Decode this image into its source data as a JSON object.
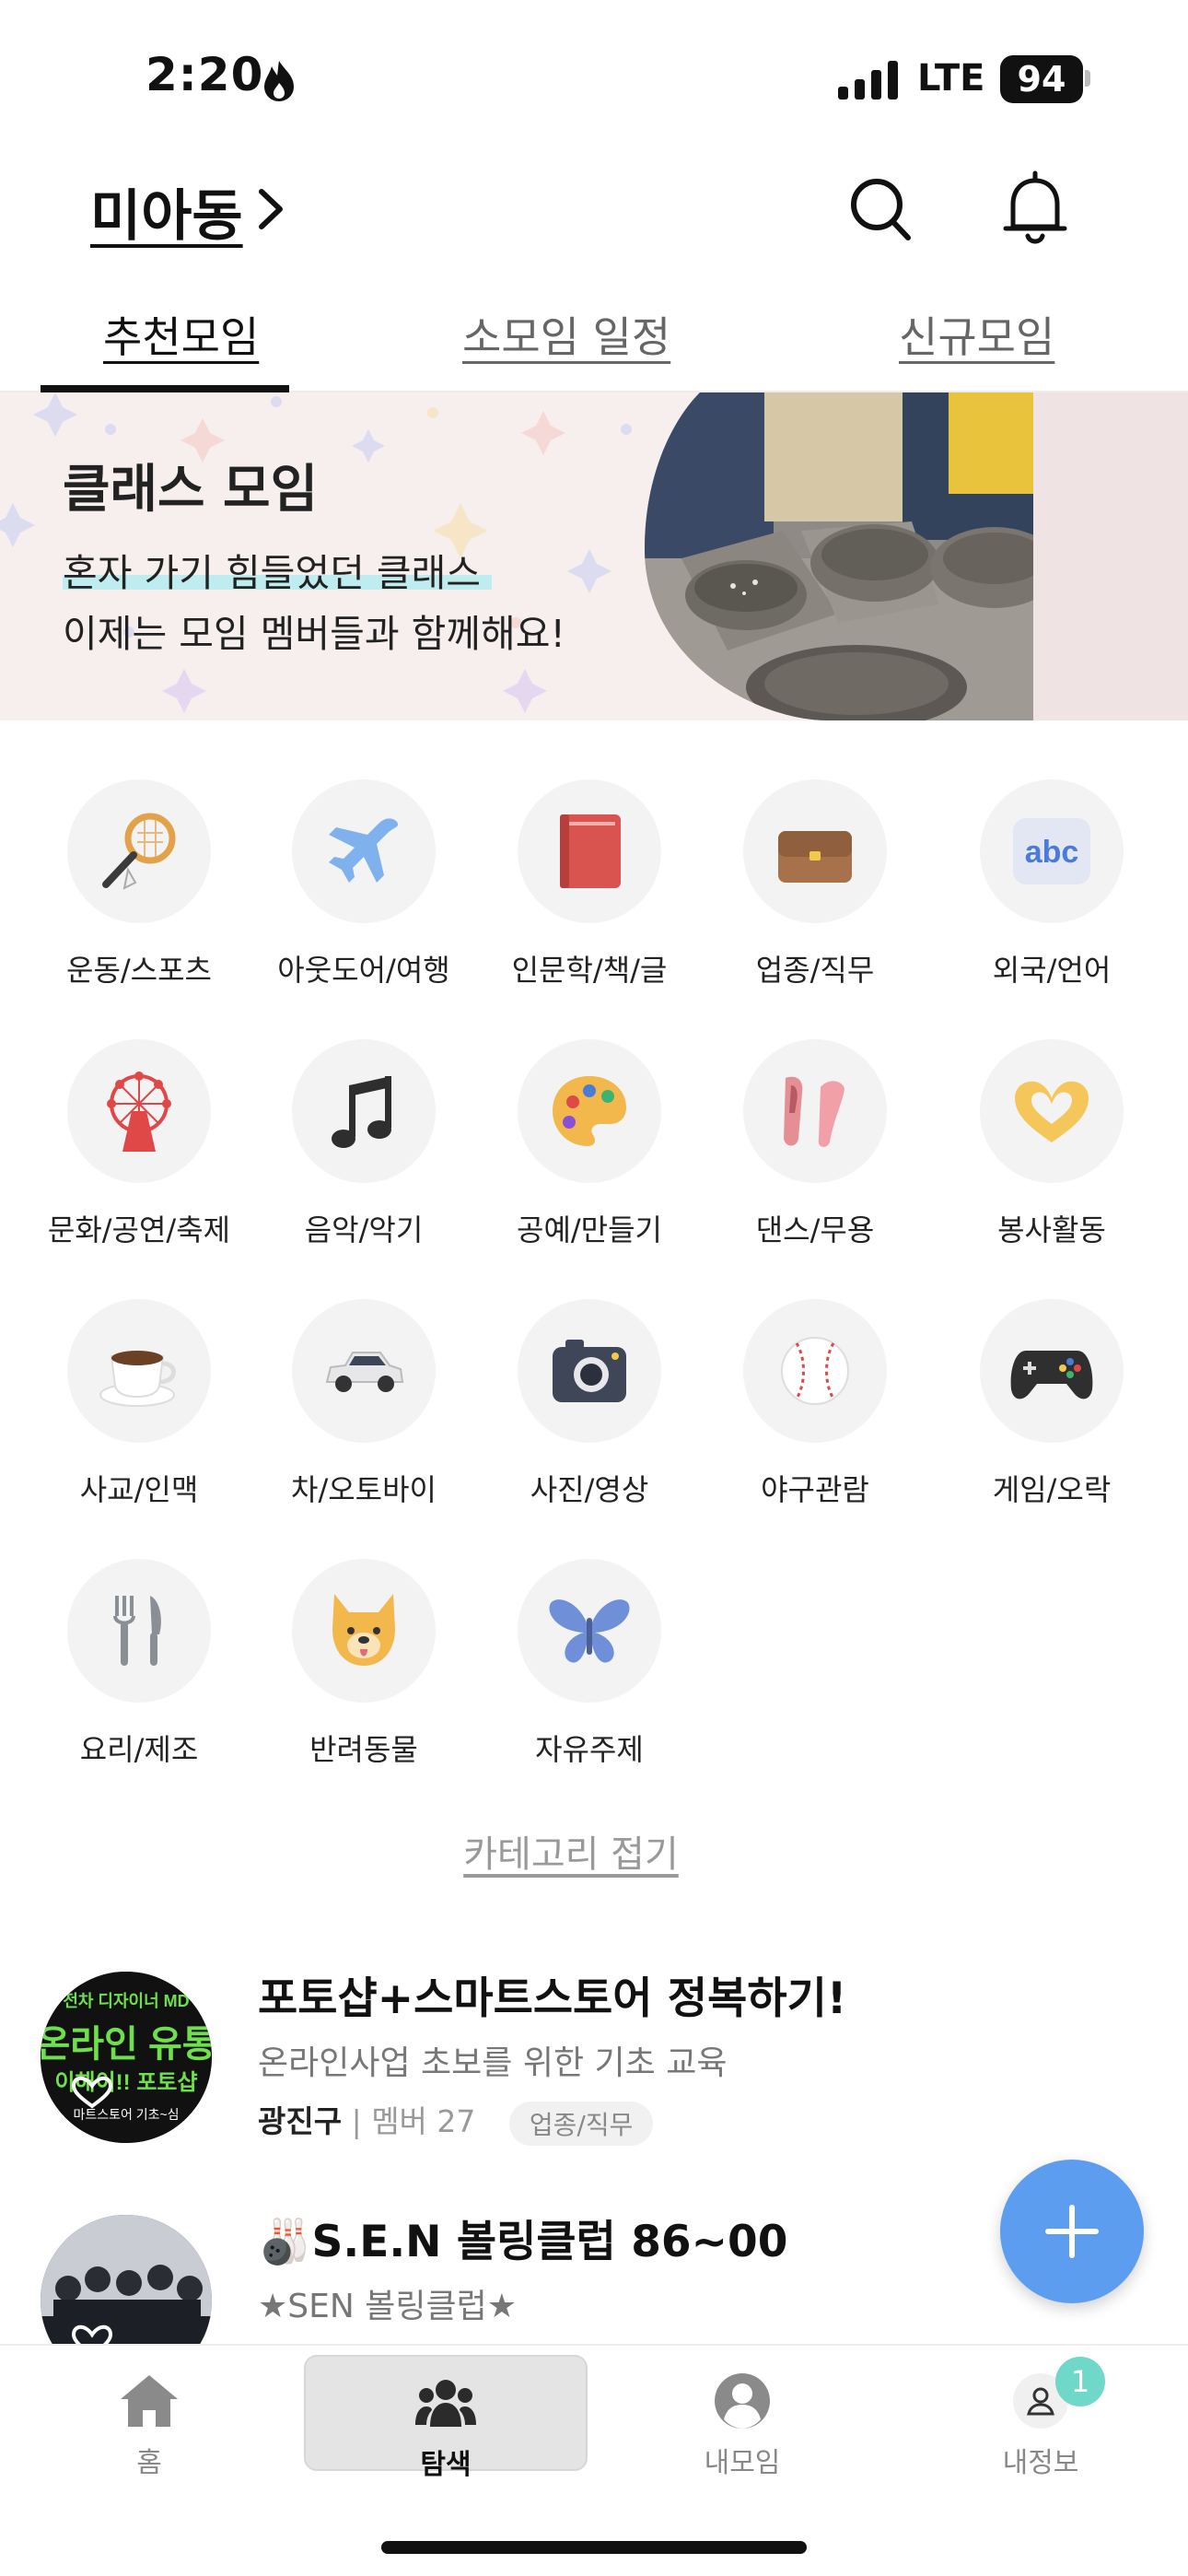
{
  "status_bar": {
    "time": "2:20",
    "network": "LTE",
    "battery": "94"
  },
  "header": {
    "location": "미아동"
  },
  "tabs": [
    {
      "label": "추천모임",
      "active": true
    },
    {
      "label": "소모임 일정",
      "active": false
    },
    {
      "label": "신규모임",
      "active": false
    }
  ],
  "banner": {
    "title": "클래스 모임",
    "line1": "혼자 가기 힘들었던 클래스",
    "line2": "이제는 모임 멤버들과 함께해요!"
  },
  "categories": [
    {
      "label": "운동/스포츠",
      "icon": "badminton-icon"
    },
    {
      "label": "아웃도어/여행",
      "icon": "airplane-icon"
    },
    {
      "label": "인문학/책/글",
      "icon": "book-icon"
    },
    {
      "label": "업종/직무",
      "icon": "briefcase-icon"
    },
    {
      "label": "외국/언어",
      "icon": "abc-icon"
    },
    {
      "label": "문화/공연/축제",
      "icon": "ferris-wheel-icon"
    },
    {
      "label": "음악/악기",
      "icon": "music-note-icon"
    },
    {
      "label": "공예/만들기",
      "icon": "palette-icon"
    },
    {
      "label": "댄스/무용",
      "icon": "ballet-shoes-icon"
    },
    {
      "label": "봉사활동",
      "icon": "heart-hands-icon"
    },
    {
      "label": "사교/인맥",
      "icon": "coffee-cup-icon"
    },
    {
      "label": "차/오토바이",
      "icon": "car-icon"
    },
    {
      "label": "사진/영상",
      "icon": "camera-icon"
    },
    {
      "label": "야구관람",
      "icon": "baseball-icon"
    },
    {
      "label": "게임/오락",
      "icon": "gamepad-icon"
    },
    {
      "label": "요리/제조",
      "icon": "fork-knife-icon"
    },
    {
      "label": "반려동물",
      "icon": "dog-icon"
    },
    {
      "label": "자유주제",
      "icon": "butterfly-icon"
    }
  ],
  "collapse_label": "카테고리 접기",
  "thumb1": {
    "line1": "전차 디자이너 MD",
    "line2": "온라인 유통",
    "line3": "이해이!! 포토샵",
    "line4": "마트스토어 기초~심"
  },
  "meetups": [
    {
      "title": "포토샵+스마트스토어 정복하기!",
      "description": "온라인사업 초보를 위한 기초 교육",
      "host": "광진구",
      "members": "| 멤버 27",
      "tag": "업종/직무"
    },
    {
      "title": "🎳S.E.N 볼링클럽 86~00",
      "description": "★SEN 볼링클럽★"
    }
  ],
  "bottom_nav": [
    {
      "label": "홈",
      "icon": "home-icon",
      "active": false
    },
    {
      "label": "탐색",
      "icon": "people-group-icon",
      "active": true
    },
    {
      "label": "내모임",
      "icon": "user-circle-icon",
      "active": false
    },
    {
      "label": "내정보",
      "icon": "profile-icon",
      "active": false,
      "badge": "1"
    }
  ],
  "colors": {
    "accent_blue": "#5d9df0",
    "badge_teal": "#6fd8c8",
    "banner_bg": "#f7eeee",
    "highlight": "#bfecee"
  }
}
